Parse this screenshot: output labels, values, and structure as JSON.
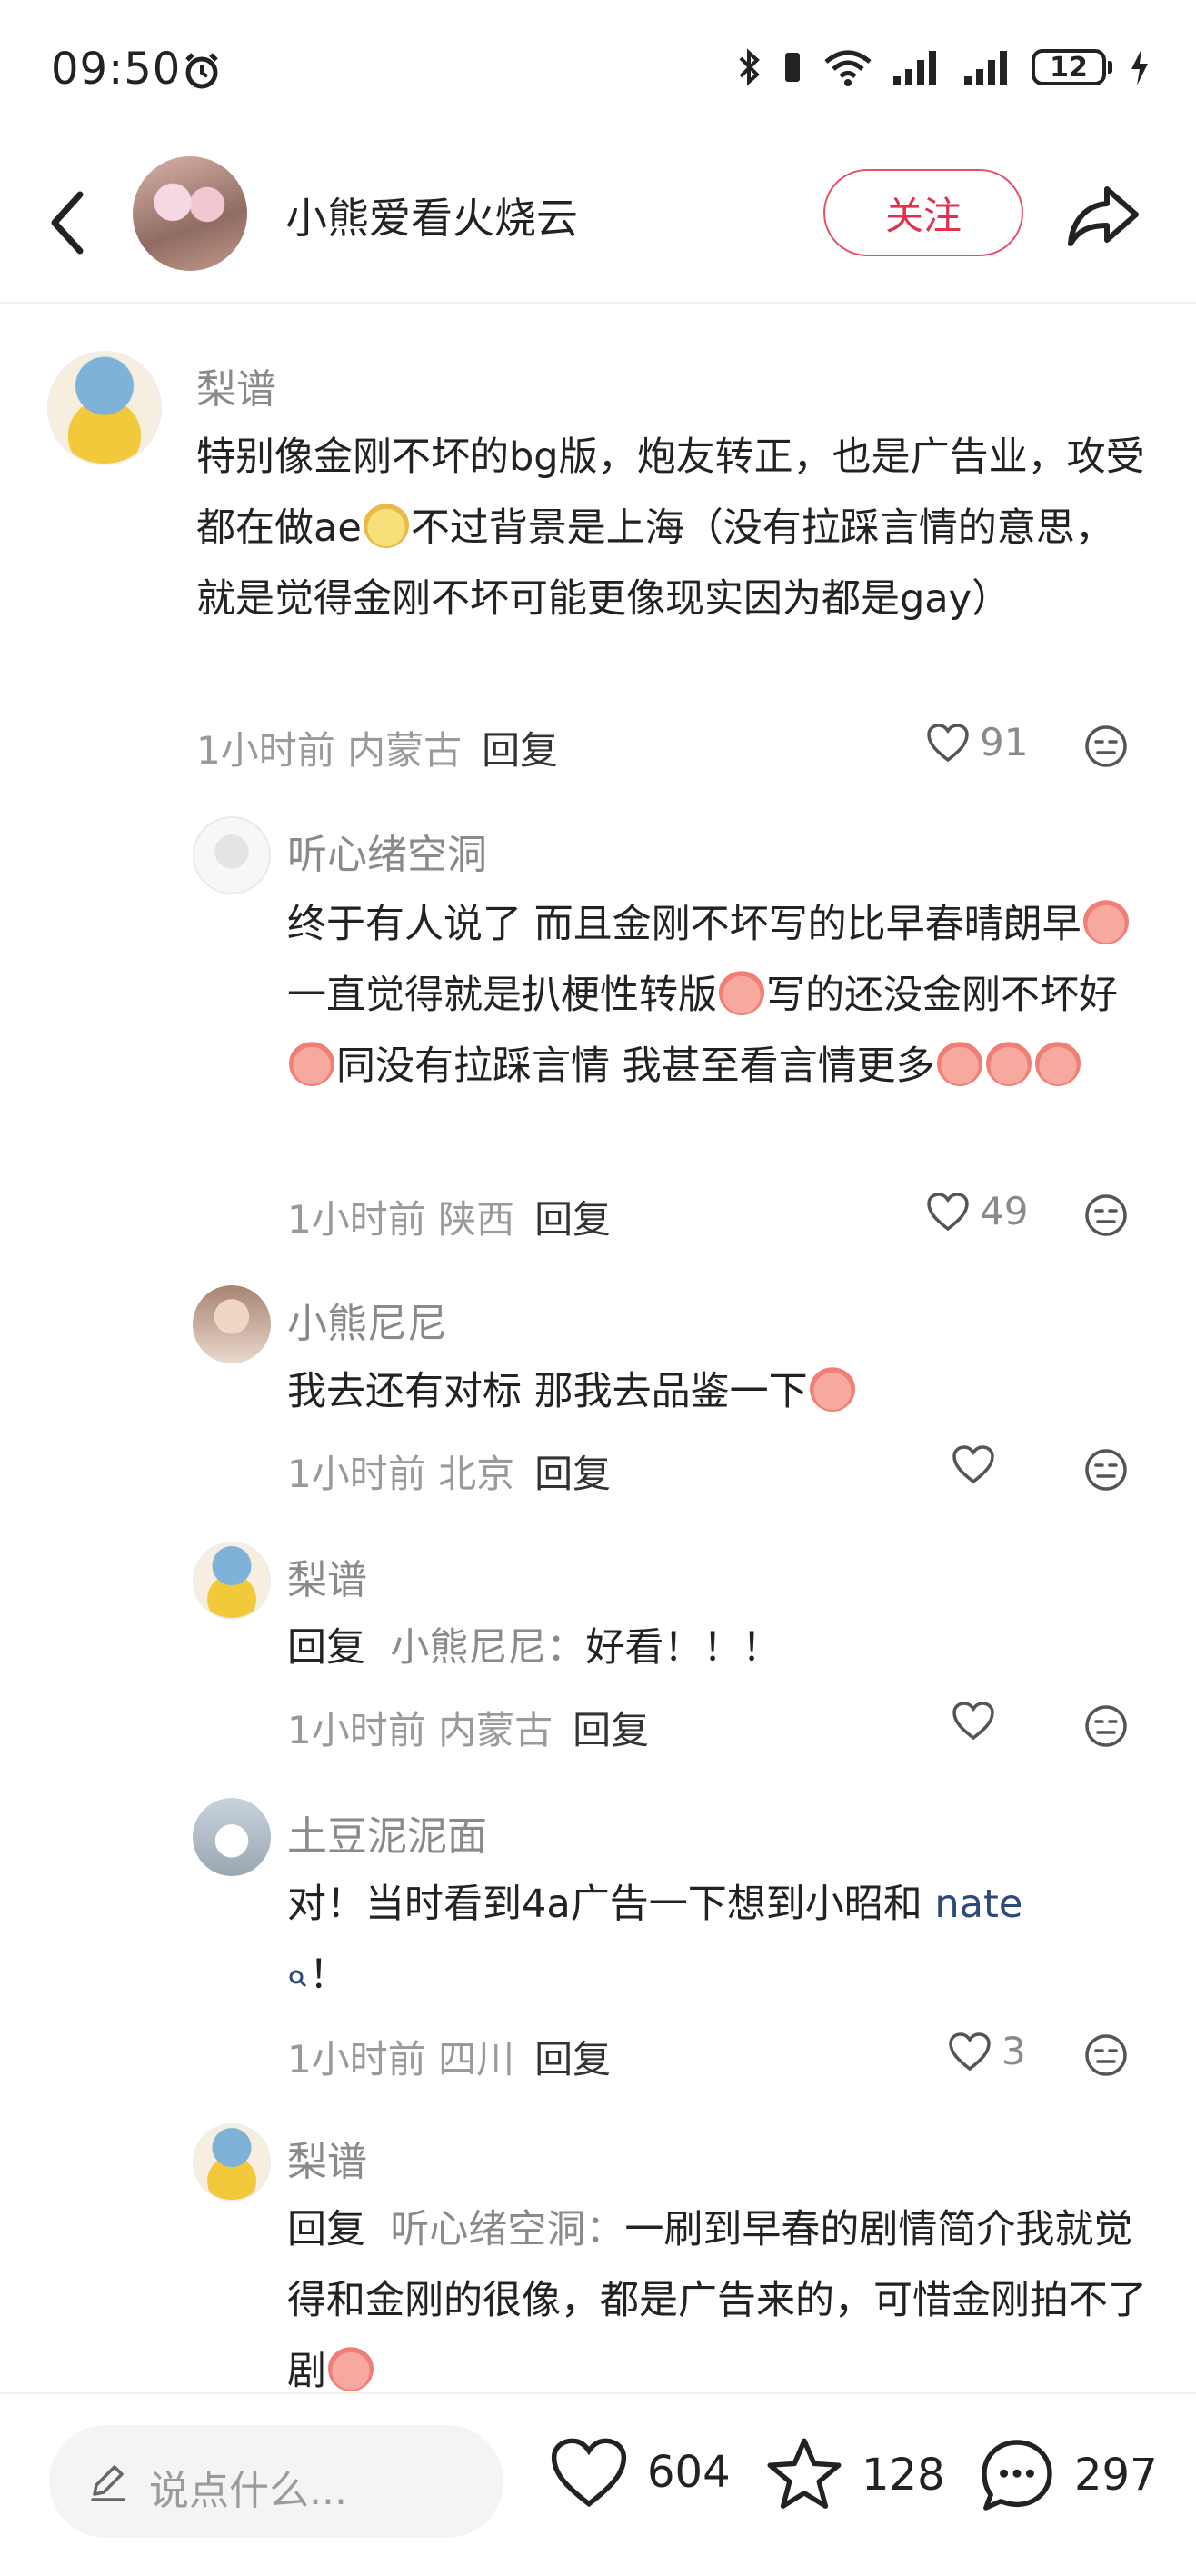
{
  "status_bar": {
    "time": "09:50",
    "battery": "12"
  },
  "header": {
    "author_name": "小熊爱看火烧云",
    "follow_label": "关注"
  },
  "comments": [
    {
      "username": "梨谱",
      "text_parts": [
        "特别像金刚不坏的bg版，炮友转正，也是广告业，攻受都在做ae",
        "不过背景是上海（没有拉踩言情的意思，就是觉得金刚不坏可能更像现实因为都是gay）"
      ],
      "time": "1小时前",
      "location": "内蒙古",
      "reply_label": "回复",
      "likes": "91"
    },
    {
      "username": "听心绪空洞",
      "text_parts": [
        "终于有人说了 而且金刚不坏写的比早春晴朗早",
        "一直觉得就是扒梗性转版",
        "写的还没金刚不坏好",
        "同没有拉踩言情 我甚至看言情更多"
      ],
      "time": "1小时前",
      "location": "陕西",
      "reply_label": "回复",
      "likes": "49"
    },
    {
      "username": "小熊尼尼",
      "text_parts": [
        "我去还有对标 那我去品鉴一下"
      ],
      "time": "1小时前",
      "location": "北京",
      "reply_label": "回复",
      "likes": ""
    },
    {
      "username": "梨谱",
      "reply_prefix": "回复",
      "reply_to": "小熊尼尼：",
      "text_parts": [
        "好看！！！"
      ],
      "time": "1小时前",
      "location": "内蒙古",
      "reply_label": "回复",
      "likes": ""
    },
    {
      "username": "土豆泥泥面",
      "text_parts": [
        "对！当时看到4a广告一下想到小昭和",
        "！"
      ],
      "hashtag": "nate",
      "time": "1小时前",
      "location": "四川",
      "reply_label": "回复",
      "likes": "3"
    },
    {
      "username": "梨谱",
      "reply_prefix": "回复",
      "reply_to": "听心绪空洞：",
      "text_parts": [
        "一刷到早春的剧情简介我就觉得和金刚的很像，都是广告来的，可惜金刚拍不了剧"
      ]
    }
  ],
  "bottom_bar": {
    "input_placeholder": "说点什么...",
    "likes": "604",
    "favorites": "128",
    "comments": "297"
  },
  "colors": {
    "accent": "#e2304f",
    "secondary_text": "#8a8a8a",
    "hashtag": "#2d4a7a"
  }
}
